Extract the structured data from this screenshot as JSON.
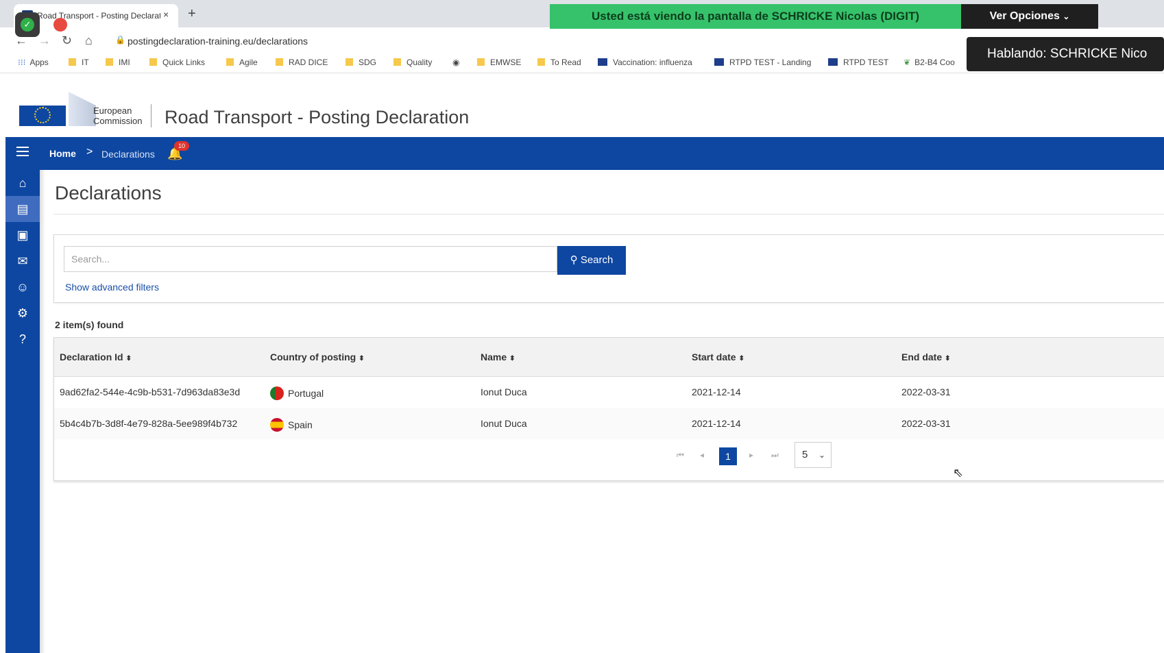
{
  "browser": {
    "tab_title": "Road Transport - Posting Declarati",
    "tab_close": "×",
    "new_tab": "+",
    "url": "postingdeclaration-training.eu/declarations",
    "bookmarks": [
      "Apps",
      "IT",
      "IMI",
      "Quick Links",
      "Agile",
      "RAD DICE",
      "SDG",
      "Quality",
      "EMWSE",
      "To Read",
      "Vaccination: influenza",
      "RTPD TEST - Landing",
      "RTPD TEST",
      "B2-B4 Coo"
    ]
  },
  "screen_share": {
    "banner": "Usted está viendo la pantalla de SCHRICKE Nicolas (DIGIT)",
    "options_label": "Ver Opciones",
    "speaking": "Hablando: SCHRICKE Nico"
  },
  "header": {
    "logo_line1": "European",
    "logo_line2": "Commission",
    "app_title": "Road Transport - Posting Declaration"
  },
  "breadcrumb": {
    "home": "Home",
    "separator": ">",
    "current": "Declarations",
    "notification_count": "10"
  },
  "page": {
    "title": "Declarations",
    "search_placeholder": "Search...",
    "search_button": "Search",
    "advanced_filters": "Show advanced filters",
    "results_count": "2 item(s) found"
  },
  "table": {
    "columns": [
      "Declaration Id",
      "Country of posting",
      "Name",
      "Start date",
      "End date"
    ],
    "rows": [
      {
        "id": "9ad62fa2-544e-4c9b-b531-7d963da83e3d",
        "country": "Portugal",
        "name": "Ionut Duca",
        "start": "2021-12-14",
        "end": "2022-03-31"
      },
      {
        "id": "5b4c4b7b-3d8f-4e79-828a-5ee989f4b732",
        "country": "Spain",
        "name": "Ionut Duca",
        "start": "2021-12-14",
        "end": "2022-03-31"
      }
    ]
  },
  "pagination": {
    "current_page": "1",
    "page_size": "5"
  },
  "colors": {
    "primary": "#0e47a1",
    "share_green": "#36c26a"
  }
}
